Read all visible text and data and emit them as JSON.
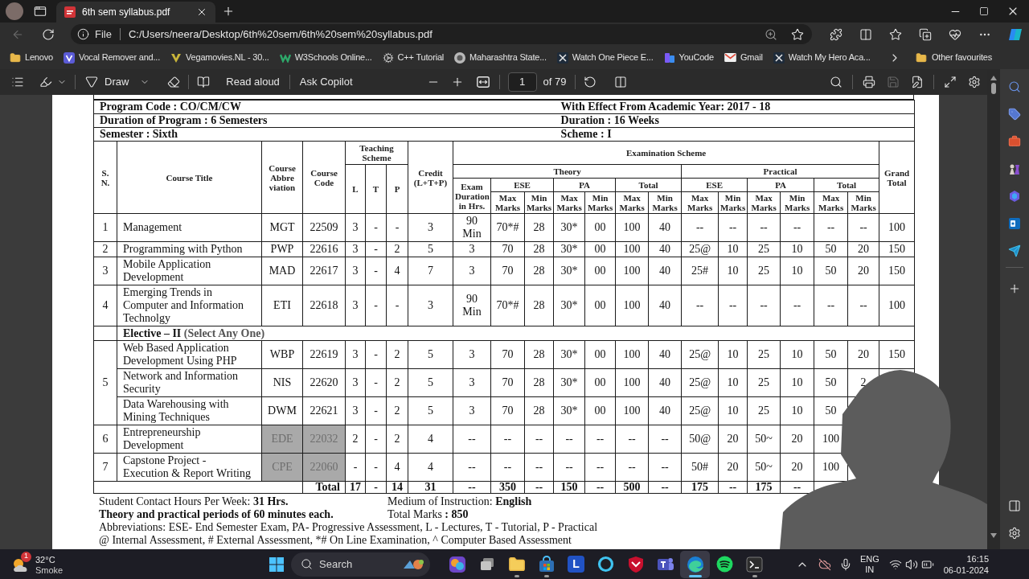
{
  "browser": {
    "tabs": [
      {
        "title": "6th sem syllabus.pdf",
        "selected": true
      }
    ],
    "back": {
      "disabled": true
    },
    "address": {
      "scheme": "File",
      "url": "C:/Users/neera/Desktop/6th%20sem/6th%20sem%20syllabus.pdf"
    }
  },
  "bookmarks": {
    "items": [
      {
        "label": "Lenovo",
        "kind": "folder"
      },
      {
        "label": "Vocal Remover and...",
        "kind": "badge"
      },
      {
        "label": "Vegamovies.NL - 30...",
        "kind": "leaf"
      },
      {
        "label": "W3Schools Online...",
        "kind": "zigzag"
      },
      {
        "label": "C++ Tutorial",
        "kind": "gear"
      },
      {
        "label": "Maharashtra State...",
        "kind": "emblem"
      },
      {
        "label": "Watch One Piece E...",
        "kind": "cross"
      },
      {
        "label": "YouCode",
        "kind": "blocks"
      },
      {
        "label": "Gmail",
        "kind": "mail"
      },
      {
        "label": "Watch My Hero Aca...",
        "kind": "cross"
      }
    ],
    "other": "Other favourites"
  },
  "pdf_toolbar": {
    "draw": "Draw",
    "read_aloud": "Read aloud",
    "ask_copilot": "Ask Copilot",
    "page": "1",
    "page_count": "of 79",
    "save": {
      "disabled": true
    }
  },
  "document": {
    "info_rows": [
      {
        "left": "Program Code : CO/CM/CW",
        "right": "With Effect From Academic Year: 2017 - 18"
      },
      {
        "left": "Duration of Program : 6 Semesters",
        "right": "Duration : 16 Weeks"
      },
      {
        "left": "Semester : Sixth",
        "right": "Scheme : I"
      }
    ],
    "header": {
      "sn": "S. N.",
      "title": "Course Title",
      "abbr": "Course Abbre viation",
      "code": "Course Code",
      "teaching": "Teaching Scheme",
      "teaching_cols": [
        "L",
        "T",
        "P"
      ],
      "credit": "Credit (L+T+P)",
      "exam": "Examination Scheme",
      "sections": [
        "Theory",
        "Practical"
      ],
      "duration": "Exam Duration in Hrs.",
      "groups": [
        "ESE",
        "PA",
        "Total",
        "ESE",
        "PA",
        "Total"
      ],
      "marks": [
        "Max Marks",
        "Min Marks",
        "Max Marks",
        "Min Marks",
        "Max Marks",
        "Min Marks",
        "Max Marks",
        "Min Marks",
        "Max Marks",
        "Min Marks",
        "Max Marks",
        "Min Marks"
      ],
      "grand": "Grand Total"
    },
    "rows": [
      {
        "kind": "course",
        "sn": "1",
        "courses": [
          {
            "title": "Management",
            "abbr": "MGT",
            "code": "22509",
            "teaching": [
              "3",
              "-",
              "-"
            ],
            "credit": "3",
            "shaded": false,
            "marks": [
              "90 Min",
              "70*#",
              "28",
              "30*",
              "00",
              "100",
              "40",
              "--",
              "--",
              "--",
              "--",
              "--",
              "--",
              "100"
            ]
          }
        ]
      },
      {
        "kind": "course",
        "sn": "2",
        "courses": [
          {
            "title": "Programming with Python",
            "abbr": "PWP",
            "code": "22616",
            "teaching": [
              "3",
              "-",
              "2"
            ],
            "credit": "5",
            "shaded": false,
            "marks": [
              "3",
              "70",
              "28",
              "30*",
              "00",
              "100",
              "40",
              "25@",
              "10",
              "25",
              "10",
              "50",
              "20",
              "150"
            ]
          }
        ]
      },
      {
        "kind": "course",
        "sn": "3",
        "courses": [
          {
            "title": "Mobile Application Development",
            "abbr": "MAD",
            "code": "22617",
            "teaching": [
              "3",
              "-",
              "4"
            ],
            "credit": "7",
            "shaded": false,
            "marks": [
              "3",
              "70",
              "28",
              "30*",
              "00",
              "100",
              "40",
              "25#",
              "10",
              "25",
              "10",
              "50",
              "20",
              "150"
            ]
          }
        ]
      },
      {
        "kind": "course",
        "sn": "4",
        "courses": [
          {
            "title": "Emerging Trends in Computer and Information Technolgy",
            "abbr": "ETI",
            "code": "22618",
            "teaching": [
              "3",
              "-",
              "-"
            ],
            "credit": "3",
            "shaded": false,
            "marks": [
              "90 Min",
              "70*#",
              "28",
              "30*",
              "00",
              "100",
              "40",
              "--",
              "--",
              "--",
              "--",
              "--",
              "--",
              "100"
            ]
          }
        ]
      },
      {
        "kind": "heading",
        "label": "Elective – II",
        "note": "(Select Any One)"
      },
      {
        "kind": "course",
        "sn": "5",
        "courses": [
          {
            "title": "Web Based Application Development Using PHP",
            "abbr": "WBP",
            "code": "22619",
            "teaching": [
              "3",
              "-",
              "2"
            ],
            "credit": "5",
            "shaded": false,
            "marks": [
              "3",
              "70",
              "28",
              "30*",
              "00",
              "100",
              "40",
              "25@",
              "10",
              "25",
              "10",
              "50",
              "20",
              "150"
            ]
          },
          {
            "title": "Network and Information Security",
            "abbr": "NIS",
            "code": "22620",
            "teaching": [
              "3",
              "-",
              "2"
            ],
            "credit": "5",
            "shaded": false,
            "marks": [
              "3",
              "70",
              "28",
              "30*",
              "00",
              "100",
              "40",
              "25@",
              "10",
              "25",
              "10",
              "50",
              "2"
            ]
          },
          {
            "title": "Data Warehousing with Mining Techniques",
            "abbr": "DWM",
            "code": "22621",
            "teaching": [
              "3",
              "-",
              "2"
            ],
            "credit": "5",
            "shaded": false,
            "marks": [
              "3",
              "70",
              "28",
              "30*",
              "00",
              "100",
              "40",
              "25@",
              "10",
              "25",
              "10",
              "50"
            ]
          }
        ]
      },
      {
        "kind": "course",
        "sn": "6",
        "courses": [
          {
            "title": "Entrepreneurship Development",
            "abbr": "EDE",
            "code": "22032",
            "teaching": [
              "2",
              "-",
              "2"
            ],
            "credit": "4",
            "shaded": true,
            "marks": [
              "--",
              "--",
              "--",
              "--",
              "--",
              "--",
              "--",
              "50@",
              "20",
              "50~",
              "20",
              "100"
            ]
          }
        ]
      },
      {
        "kind": "course",
        "sn": "7",
        "courses": [
          {
            "title": "Capstone Project - Execution & Report Writing",
            "abbr": "CPE",
            "code": "22060",
            "teaching": [
              "-",
              "-",
              "4"
            ],
            "credit": "4",
            "shaded": true,
            "marks": [
              "--",
              "--",
              "--",
              "--",
              "--",
              "--",
              "--",
              "50#",
              "20",
              "50~",
              "20",
              "100"
            ]
          }
        ]
      },
      {
        "kind": "total",
        "label": "Total",
        "teaching": [
          "17",
          "-",
          "14"
        ],
        "credit": "31",
        "marks": [
          "--",
          "350",
          "--",
          "150",
          "--",
          "500",
          "--",
          "175",
          "--",
          "175",
          "--"
        ]
      }
    ],
    "notes": {
      "contact_hours": "Student Contact Hours Per Week: **31 Hrs.**",
      "medium": "Medium of Instruction: **English**",
      "periods": "Theory and practical periods of 60 minutes each.",
      "total_marks": "Total Marks **: 850**",
      "abbreviations": "Abbreviations: ESE- End Semester Exam, PA- Progressive Assessment, L - Lectures, T - Tutorial, P - Practical",
      "legend": "@ Internal Assessment, # External Assessment, *# On Line Examination, ^ Computer Based Assessment"
    }
  },
  "taskbar": {
    "weather": {
      "badge": "1",
      "temp": "32°C",
      "condition": "Smoke"
    },
    "search": {
      "placeholder": "Search"
    },
    "apps": [
      {
        "kind": "copilot_pre",
        "running": false,
        "selected": false
      },
      {
        "kind": "task_view",
        "running": false,
        "selected": false
      },
      {
        "kind": "explorer",
        "running": true,
        "selected": false
      },
      {
        "kind": "store",
        "running": true,
        "selected": false
      },
      {
        "kind": "letter",
        "label": "L",
        "running": false,
        "selected": false
      },
      {
        "kind": "ring",
        "running": false,
        "selected": false
      },
      {
        "kind": "shield",
        "running": false,
        "selected": false
      },
      {
        "kind": "teams",
        "running": false,
        "selected": false
      },
      {
        "kind": "edge",
        "running": true,
        "selected": true
      },
      {
        "kind": "spotify",
        "running": false,
        "selected": false
      },
      {
        "kind": "terminal",
        "running": true,
        "selected": false
      }
    ],
    "tray": {
      "lang": "ENG",
      "region": "IN",
      "time": "16:15",
      "date": "06-01-2024"
    }
  }
}
